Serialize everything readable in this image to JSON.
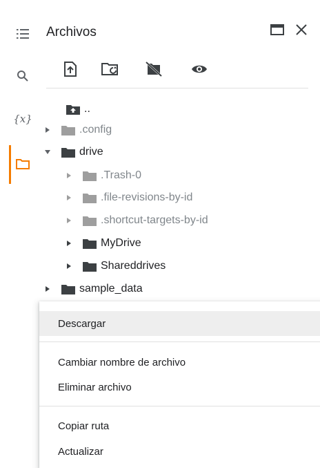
{
  "sidebar": {
    "icons": [
      {
        "name": "table-of-contents-icon"
      },
      {
        "name": "search-icon"
      },
      {
        "name": "variables-icon",
        "glyph": "{x}"
      },
      {
        "name": "files-icon"
      }
    ],
    "active_color": "#f57c00"
  },
  "panel": {
    "title": "Archivos",
    "toolbar": [
      "upload-icon",
      "mount-drive-icon",
      "hide-drive-icon",
      "show-hidden-files-icon"
    ]
  },
  "tree": {
    "parent_label": "..",
    "items": [
      {
        "label": ".config",
        "dim": true,
        "expanded": false
      },
      {
        "label": "drive",
        "dim": false,
        "expanded": true
      },
      {
        "label": ".Trash-0",
        "dim": true
      },
      {
        "label": ".file-revisions-by-id",
        "dim": true
      },
      {
        "label": ".shortcut-targets-by-id",
        "dim": true
      },
      {
        "label": "MyDrive",
        "dim": false
      },
      {
        "label": "Shareddrives",
        "dim": false
      },
      {
        "label": "sample_data",
        "dim": false
      }
    ]
  },
  "context_menu": {
    "items": [
      {
        "label": "Descargar",
        "highlighted": true
      },
      {
        "label": "Cambiar nombre de archivo"
      },
      {
        "label": "Eliminar archivo"
      },
      {
        "label": "Copiar ruta"
      },
      {
        "label": "Actualizar"
      }
    ]
  }
}
